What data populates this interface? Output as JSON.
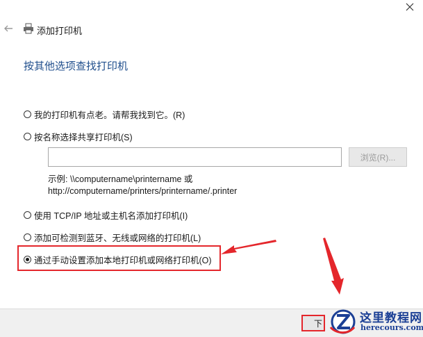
{
  "window": {
    "title": "添加打印机",
    "back_icon": "back-arrow-icon",
    "close_icon": "close-icon",
    "title_icon": "printer-icon"
  },
  "heading": "按其他选项查找打印机",
  "options": [
    {
      "label": "我的打印机有点老。请帮我找到它。(R)",
      "selected": false
    },
    {
      "label": "按名称选择共享打印机(S)",
      "selected": false
    },
    {
      "label": "使用 TCP/IP 地址或主机名添加打印机(I)",
      "selected": false
    },
    {
      "label": "添加可检测到蓝牙、无线或网络的打印机(L)",
      "selected": false
    },
    {
      "label": "通过手动设置添加本地打印机或网络打印机(O)",
      "selected": true
    }
  ],
  "share_name": {
    "value": "",
    "placeholder": ""
  },
  "browse_label": "浏览(R)...",
  "example": {
    "line1": "示例: \\\\computername\\printername 或",
    "line2": "http://computername/printers/printername/.printer"
  },
  "footer": {
    "next_label": "下"
  },
  "watermark": {
    "name": "这里教程网",
    "url": "herecours.com"
  },
  "colors": {
    "heading": "#1f4e8c",
    "highlight": "#e4262b",
    "watermark": "#1b3f95"
  }
}
